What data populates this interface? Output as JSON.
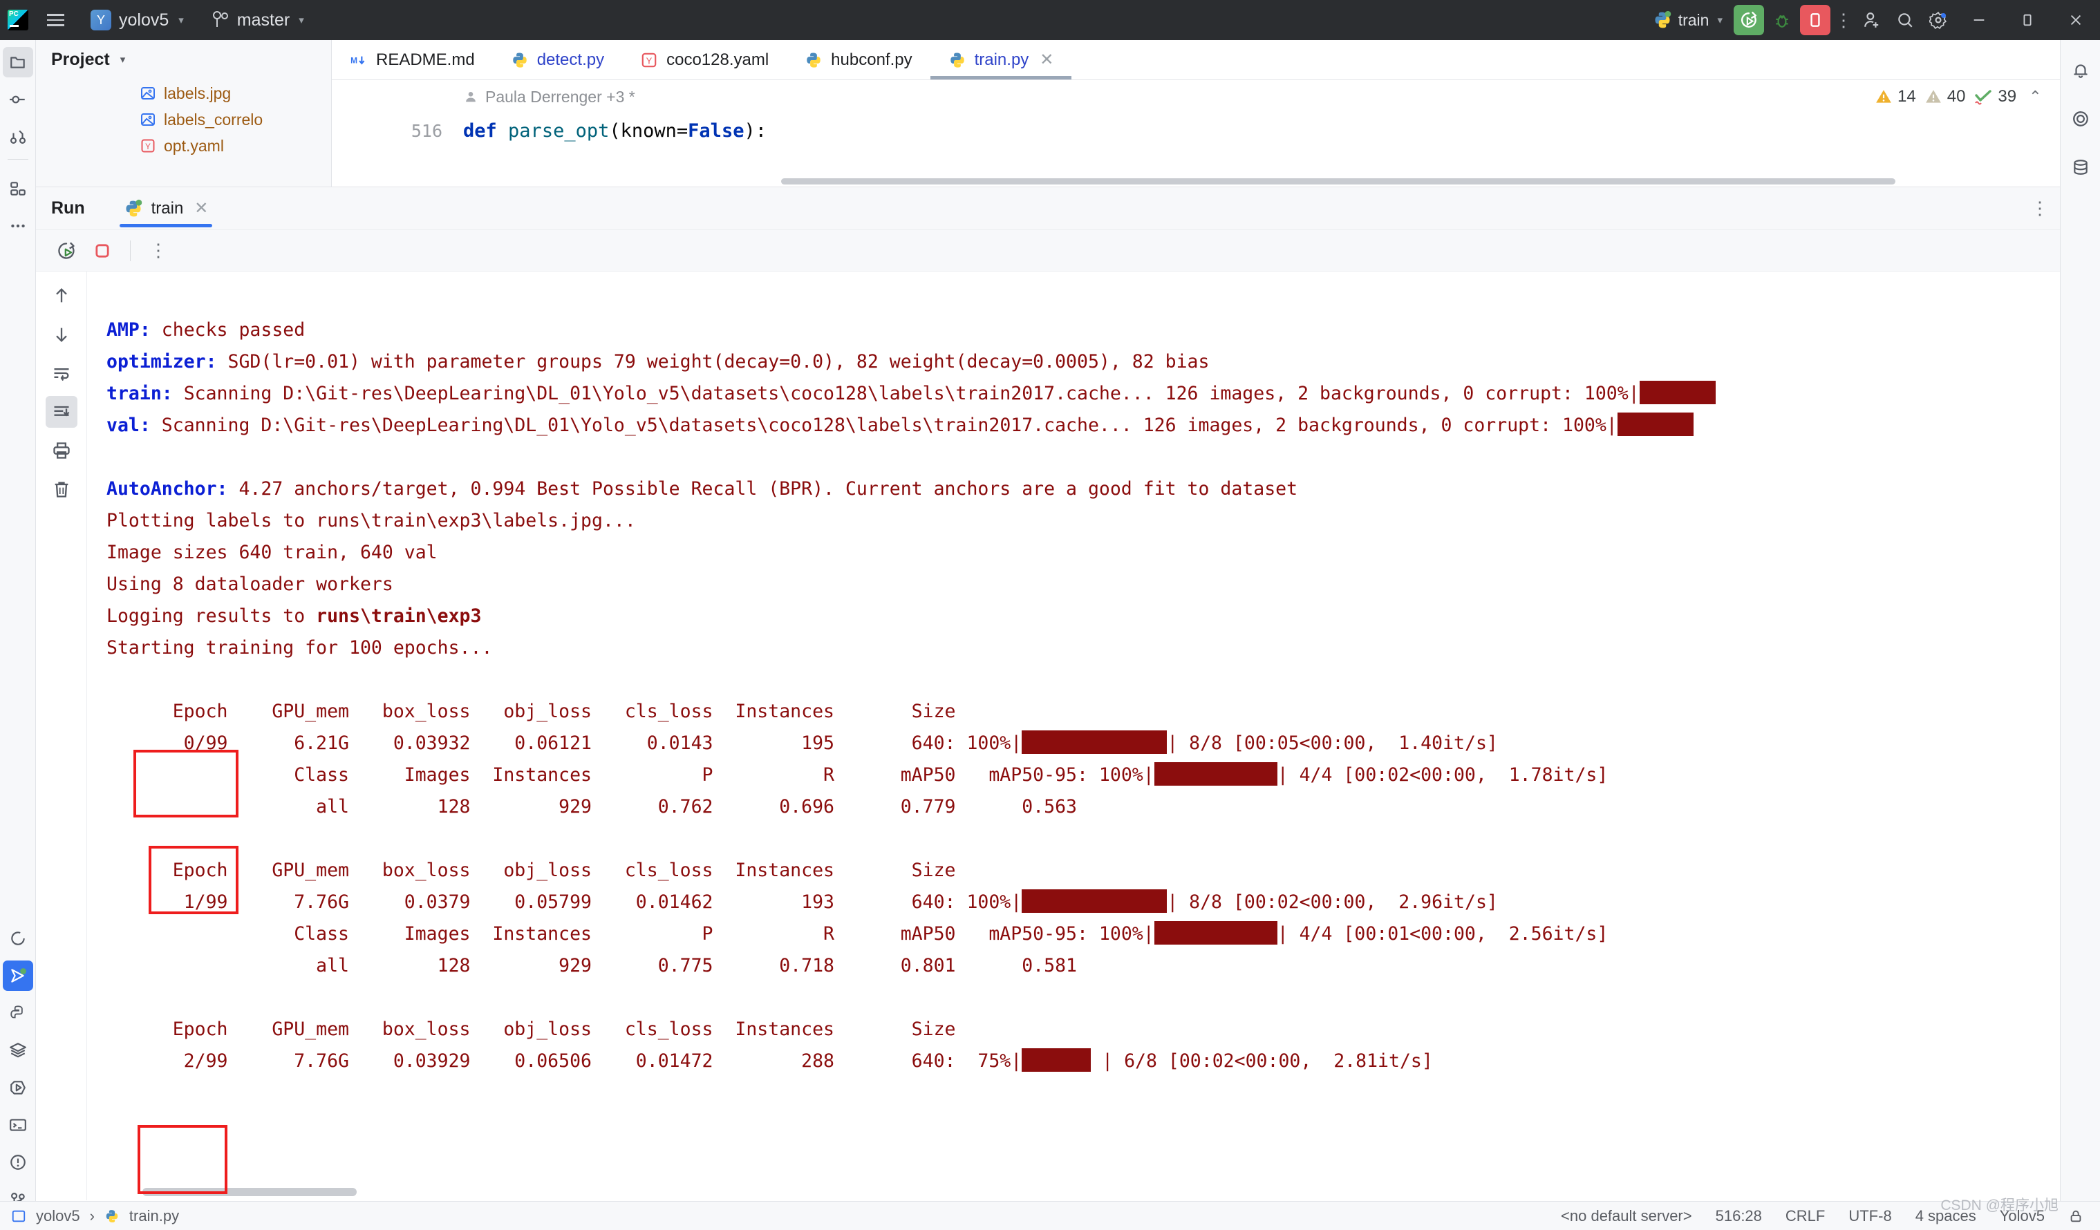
{
  "titlebar": {
    "project": "yolov5",
    "project_badge": "Y",
    "branch": "master",
    "run_config": "train",
    "icons": {
      "menu": "hamburger-icon",
      "logo": "pycharm-logo-icon",
      "run": "run-icon",
      "debug": "debug-icon",
      "stop": "stop-icon",
      "more": "more-vertical-icon",
      "share": "add-user-icon",
      "search": "search-icon",
      "settings": "gear-icon",
      "minimize": "minimize-icon",
      "maximize": "maximize-icon",
      "close": "close-icon"
    }
  },
  "project_panel": {
    "title": "Project",
    "files": [
      {
        "name": "labels.jpg",
        "icon": "image-file-icon"
      },
      {
        "name": "labels_correlo",
        "icon": "image-file-icon"
      },
      {
        "name": "opt.yaml",
        "icon": "yaml-file-icon"
      }
    ]
  },
  "tabs": [
    {
      "label": "README.md",
      "icon": "markdown-icon",
      "active": false,
      "modified": false
    },
    {
      "label": "detect.py",
      "icon": "python-icon",
      "active": false,
      "modified": true
    },
    {
      "label": "coco128.yaml",
      "icon": "yaml-file-icon",
      "active": false,
      "modified": false
    },
    {
      "label": "hubconf.py",
      "icon": "python-icon",
      "active": false,
      "modified": false
    },
    {
      "label": "train.py",
      "icon": "python-icon",
      "active": true,
      "modified": true
    }
  ],
  "editor": {
    "blame": "Paula Derrenger +3 *",
    "inspections": {
      "warnings": "14",
      "weak_warnings": "40",
      "typos": "39",
      "up": "⌃",
      "down": "⌄"
    },
    "line_number": "516",
    "code": {
      "kw_def": "def",
      "fn_name": "parse_opt",
      "paren_open": "(",
      "param": "known=",
      "kw_false": "False",
      "paren_close": "):"
    }
  },
  "run_panel": {
    "title": "Run",
    "tab_label": "train",
    "toolbar": {
      "rerun": "rerun-icon",
      "stop": "stop-icon",
      "more": "more-vertical-icon",
      "minimize": "minimize-icon"
    },
    "gutter": {
      "up": "arrow-up-icon",
      "down": "arrow-down-icon",
      "soft_wrap": "soft-wrap-icon",
      "scroll_end": "scroll-to-end-icon",
      "print": "print-icon",
      "delete": "trash-icon"
    }
  },
  "console": {
    "lines": [
      {
        "prefix": "AMP:",
        "text": " checks passed"
      },
      {
        "prefix": "optimizer:",
        "text": " SGD(lr=0.01) with parameter groups 79 weight(decay=0.0), 82 weight(decay=0.0005), 82 bias"
      },
      {
        "prefix": "train:",
        "text": " Scanning D:\\Git-res\\DeepLearing\\DL_01\\Yolo_v5\\datasets\\coco128\\labels\\train2017.cache... 126 images, 2 backgrounds, 0 corrupt: 100%|",
        "bar": 1
      },
      {
        "prefix": "val:",
        "text": " Scanning D:\\Git-res\\DeepLearing\\DL_01\\Yolo_v5\\datasets\\coco128\\labels\\train2017.cache... 126 images, 2 backgrounds, 0 corrupt: 100%|",
        "bar": 1
      },
      {
        "prefix": "",
        "text": ""
      },
      {
        "prefix": "AutoAnchor:",
        "text": " 4.27 anchors/target, 0.994 Best Possible Recall (BPR). Current anchors are a good fit to dataset"
      },
      {
        "prefix": "",
        "text": "Plotting labels to runs\\train\\exp3\\labels.jpg..."
      },
      {
        "prefix": "",
        "text": "Image sizes 640 train, 640 val"
      },
      {
        "prefix": "",
        "text": "Using 8 dataloader workers"
      },
      {
        "prefix": "",
        "text": "Logging results to ",
        "bold_tail": "runs\\train\\exp3"
      },
      {
        "prefix": "",
        "text": "Starting training for 100 epochs..."
      }
    ],
    "epoch_header": "      Epoch    GPU_mem   box_loss   obj_loss   cls_loss  Instances       Size",
    "val_header": "                 Class     Images  Instances          P          R      mAP50   mAP50-95: ",
    "epochs": [
      {
        "row": "       0/99      6.21G    0.03932    0.06121     0.0143        195       640: 100%|",
        "train_bar_end": "| 8/8 [00:05<00:00,  1.40it/s]",
        "val_pct": "100%|",
        "val_bar_end": "| 4/4 [00:02<00:00,  1.78it/s]",
        "metrics": "                   all        128        929      0.762      0.696      0.779      0.563"
      },
      {
        "row": "       1/99      7.76G     0.0379    0.05799    0.01462        193       640: 100%|",
        "train_bar_end": "| 8/8 [00:02<00:00,  2.96it/s]",
        "val_pct": "100%|",
        "val_bar_end": "| 4/4 [00:01<00:00,  2.56it/s]",
        "metrics": "                   all        128        929      0.775      0.718      0.801      0.581"
      },
      {
        "row": "       2/99      7.76G    0.03929    0.06506    0.01472        288       640:  75%|",
        "train_bar_end": " | 6/8 [00:02<00:00,  2.81it/s]",
        "val_pct": "",
        "val_bar_end": "",
        "metrics": ""
      }
    ],
    "mAP_label_prefix": "mAP50    mAP50-95: "
  },
  "statusbar": {
    "breadcrumb_project": "yolov5",
    "breadcrumb_file": "train.py",
    "server": "<no default server>",
    "caret": "516:28",
    "line_sep": "CRLF",
    "encoding": "UTF-8",
    "indent": "4 spaces",
    "branch": "Yolov5"
  },
  "watermark": "CSDN @程序小旭",
  "colors": {
    "accent": "#3574f0",
    "console_text": "#8b0d0d",
    "console_prefix": "#0b1fd4",
    "annotation": "#ee1d1d",
    "titlebar_bg": "#2b2d30"
  }
}
